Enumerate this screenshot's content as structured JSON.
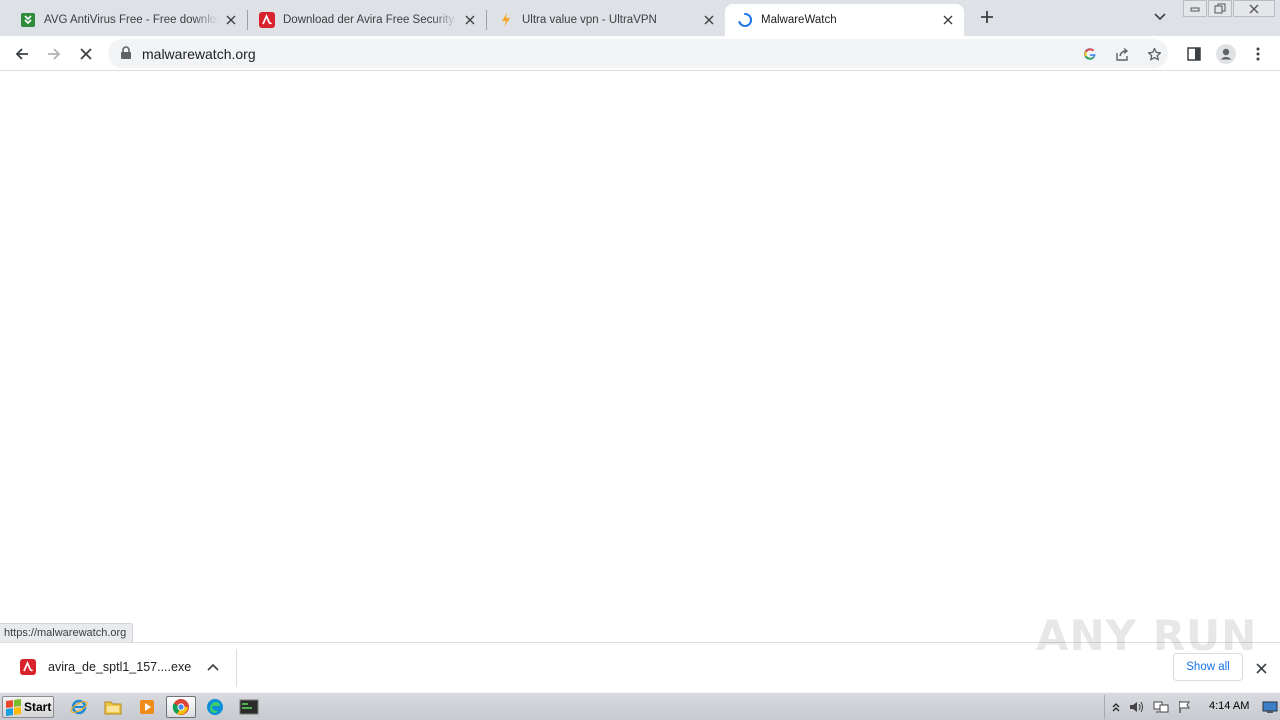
{
  "browser": {
    "tabs": [
      {
        "title": "AVG AntiVirus Free - Free download",
        "favicon": "avg-download-icon",
        "active": false
      },
      {
        "title": "Download der Avira Free Security Sc",
        "favicon": "avira-icon",
        "active": false
      },
      {
        "title": "Ultra value vpn - UltraVPN",
        "favicon": "ultravpn-bolt-icon",
        "active": false
      },
      {
        "title": "MalwareWatch",
        "favicon": "loading-spinner-icon",
        "active": true
      }
    ],
    "address_bar": {
      "url": "malwarewatch.org"
    },
    "status_url": "https://malwarewatch.org"
  },
  "download_shelf": {
    "filename": "avira_de_sptl1_157....exe",
    "show_all_label": "Show all"
  },
  "watermark": {
    "text": "ANY RUN"
  },
  "taskbar": {
    "start_label": "Start",
    "clock": "4:14 AM"
  },
  "colors": {
    "avg_green": "#2e8b3c",
    "avira_red": "#d8222c",
    "ultravpn_orange": "#f5a623",
    "spinner_blue": "#1a73e8",
    "link_blue": "#1a73e8"
  }
}
